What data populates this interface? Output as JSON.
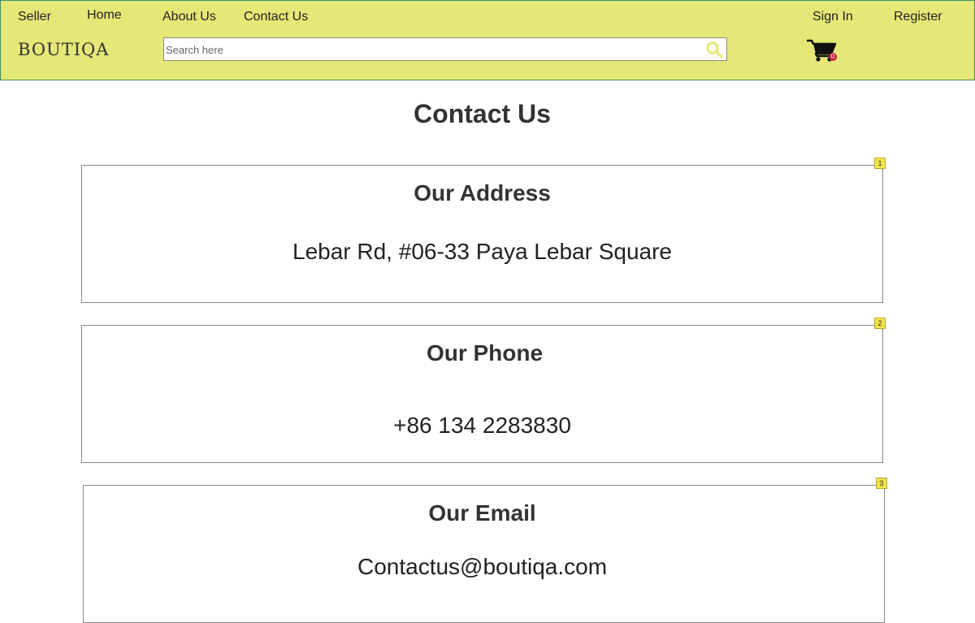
{
  "header": {
    "nav": {
      "seller": "Seller",
      "home": "Home",
      "about": "About Us",
      "contact": "Contact Us",
      "sign_in": "Sign In",
      "register": "Register"
    },
    "logo": "BOUTIQA",
    "search": {
      "placeholder": "Search here",
      "value": "",
      "icon": "search-icon"
    },
    "cart": {
      "icon": "shopping-cart-icon",
      "count": "0"
    },
    "colors": {
      "background": "#e5e876",
      "border": "#3a8f6e",
      "search_icon": "#e5e876",
      "cart_badge": "#c0213a"
    }
  },
  "main": {
    "title": "Contact Us",
    "cards": [
      {
        "badge": "1",
        "title": "Our Address",
        "value": "Lebar Rd, #06-33 Paya Lebar Square"
      },
      {
        "badge": "2",
        "title": "Our Phone",
        "value": "+86 134 2283830"
      },
      {
        "badge": "3",
        "title": "Our Email",
        "value": "Contactus@boutiqa.com"
      }
    ]
  }
}
